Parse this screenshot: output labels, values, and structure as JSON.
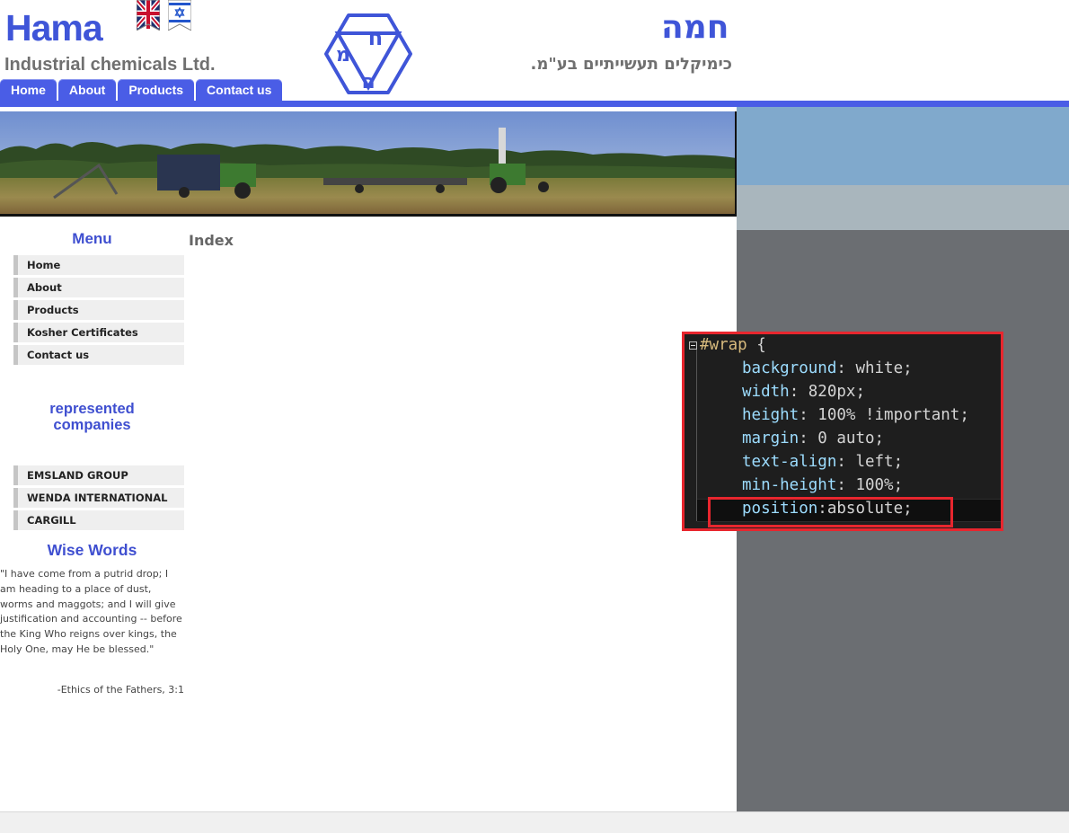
{
  "header": {
    "brand_en": "Hama",
    "subtitle_en": "Industrial chemicals Ltd.",
    "brand_he": "חמה",
    "subtitle_he": "כימיקלים תעשייתיים בע\"מ.",
    "logo_letters": [
      "ח",
      "מ",
      "ה"
    ],
    "flags": [
      "uk-flag-icon",
      "israel-flag-icon"
    ]
  },
  "topnav": [
    "Home",
    "About",
    "Products",
    "Contact us"
  ],
  "sidebar": {
    "menu_title": "Menu",
    "menu": [
      "Home",
      "About",
      "Products",
      "Kosher Certificates",
      "Contact us"
    ],
    "companies_title_1": "represented",
    "companies_title_2": "companies",
    "companies": [
      "EMSLAND GROUP",
      "WENDA INTERNATIONAL",
      "CARGILL"
    ],
    "wise_title": "Wise Words",
    "quote": "\"I have come from a putrid drop; I am heading to a place of dust, worms and maggots; and I will give justification and accounting -- before the King Who reigns over kings, the Holy One, may He be blessed.\"",
    "quote_source": "-Ethics of the Fathers, 3:1"
  },
  "main": {
    "title": "Index"
  },
  "code": {
    "selector": "#wrap",
    "open_brace": "{",
    "lines": [
      {
        "prop": "background",
        "value": "white;"
      },
      {
        "prop": "width",
        "value": "820px;"
      },
      {
        "prop": "height",
        "value": "100% !important;"
      },
      {
        "prop": "margin",
        "value": "0 auto;"
      },
      {
        "prop": "text-align",
        "value": "left;"
      },
      {
        "prop": "min-height",
        "value": "100%;"
      },
      {
        "prop": "position",
        "value": "absolute;"
      }
    ]
  },
  "colors": {
    "brand_blue": "#3f55d8",
    "nav_blue": "#4a5de6",
    "highlight_red": "#e8262e",
    "code_bg": "#1e1e1e"
  }
}
